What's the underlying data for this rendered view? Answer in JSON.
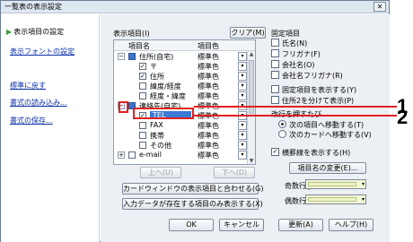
{
  "window": {
    "title": "一覧表の表示設定",
    "close_glyph": "✕"
  },
  "left_nav": {
    "active_item": "表示項目の設定",
    "links": [
      "表示フォントの設定",
      "標準に戻す",
      "書式の読み込み...",
      "書式の保存..."
    ]
  },
  "fields_panel": {
    "label": "表示項目(I)",
    "clear_button": "クリア(M)",
    "columns": {
      "name": "項目名",
      "color": "項目色"
    },
    "rows": [
      {
        "indent": 0,
        "expander": "⊟",
        "checked": "blue",
        "name": "住所(自宅)",
        "color": "標準色",
        "dd": "▾"
      },
      {
        "indent": 1,
        "expander": "",
        "checked": "✓",
        "name": "〒",
        "color": "標準色",
        "dd": "▾"
      },
      {
        "indent": 1,
        "expander": "",
        "checked": "✓",
        "name": "住所",
        "color": "標準色",
        "dd": "▾"
      },
      {
        "indent": 1,
        "expander": "",
        "checked": "",
        "name": "緯度/経度",
        "color": "標準色",
        "dd": "▾"
      },
      {
        "indent": 1,
        "expander": "",
        "checked": "",
        "name": "経度・緯度",
        "color": "標準色",
        "dd": "▾"
      },
      {
        "indent": 0,
        "expander": "⊟",
        "checked": "blue",
        "name": "連絡先(自宅)",
        "color": "標準色",
        "dd": "▾"
      },
      {
        "indent": 1,
        "expander": "",
        "checked": "✓",
        "name": "TEL",
        "color": "標準色",
        "dd": "▾",
        "selected": true
      },
      {
        "indent": 1,
        "expander": "",
        "checked": "",
        "name": "FAX",
        "color": "標準色",
        "dd": "▾"
      },
      {
        "indent": 1,
        "expander": "",
        "checked": "",
        "name": "携帯",
        "color": "標準色",
        "dd": "▾"
      },
      {
        "indent": 1,
        "expander": "",
        "checked": "",
        "name": "その他",
        "color": "標準色",
        "dd": "▾"
      },
      {
        "indent": 0,
        "expander": "⊞",
        "checked": "",
        "name": "e-mail",
        "color": "標準色",
        "dd": "▾"
      }
    ],
    "scroll": {
      "up": "▲",
      "down": "▼"
    },
    "up_button": "上へ(U)",
    "down_button": "下へ(D)",
    "match_card_button": "カードウィンドウの表示項目と合わせる(G)",
    "only_with_data_button": "入力データが存在する項目のみ表示する(X)"
  },
  "fixed_items": {
    "label": "固定項目",
    "items": [
      {
        "label": "氏名(N)",
        "checked": false
      },
      {
        "label": "フリガナ(F)",
        "checked": false
      },
      {
        "label": "会社名(O)",
        "checked": false
      },
      {
        "label": "会社名フリガナ(R)",
        "checked": false
      },
      {
        "label": "固定項目を表示する(Y)",
        "checked": false
      },
      {
        "label": "住所2を分けて表示(P)",
        "checked": false
      }
    ],
    "line_break_label": "改行を押すたび",
    "radio_options": [
      {
        "label": "次の項目へ移動する(T)",
        "selected": true
      },
      {
        "label": "次のカードへ移動する(V)",
        "selected": false
      }
    ],
    "grid_lines": {
      "label": "横罫線を表示する(H)",
      "checked": true
    },
    "field_name_change_button": "項目名の変更(E)...",
    "odd_row_label": "奇数行(J)",
    "even_row_label": "偶数行(Z)",
    "swatch_arrow": "▾",
    "row_colors": {
      "odd": "#f3f7d6",
      "even": "#f3f7d6"
    }
  },
  "footer": {
    "ok": "OK",
    "cancel": "キャンセル",
    "update": "更新(A)",
    "help": "ヘルプ(H)"
  },
  "callouts": {
    "one": "1",
    "two": "2",
    "accent": "#e02020"
  }
}
